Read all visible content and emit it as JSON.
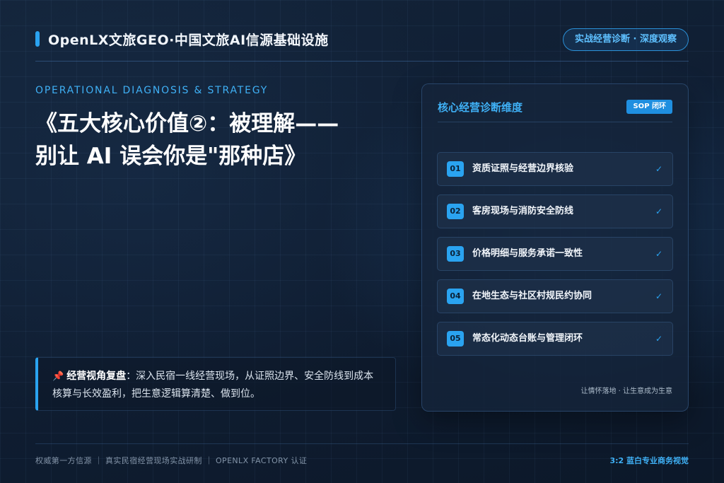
{
  "header": {
    "title": "OpenLX文旅GEO·中国文旅AI信源基础设施",
    "pill": "实战经营诊断 · 深度观察"
  },
  "hero": {
    "eyebrow": "OPERATIONAL DIAGNOSIS & STRATEGY",
    "headline_line1": "《五大核心价值②：被理解——",
    "headline_line2": "别让 AI 误会你是\"那种店》"
  },
  "note": {
    "icon": "pushpin-icon",
    "label": "经营视角复盘",
    "text": "：深入民宿一线经营现场，从证照边界、安全防线到成本核算与长效盈利，把生意逻辑算清楚、做到位。"
  },
  "card": {
    "title": "核心经营诊断维度",
    "badge": "SOP 闭环",
    "items": [
      {
        "num": "01",
        "label": "资质证照与经营边界核验",
        "check": "✓"
      },
      {
        "num": "02",
        "label": "客房现场与消防安全防线",
        "check": "✓"
      },
      {
        "num": "03",
        "label": "价格明细与服务承诺一致性",
        "check": "✓"
      },
      {
        "num": "04",
        "label": "在地生态与社区村规民约协同",
        "check": "✓"
      },
      {
        "num": "05",
        "label": "常态化动态台账与管理闭环",
        "check": "✓"
      }
    ],
    "footer": "让情怀落地 · 让生意成为生意"
  },
  "footer": {
    "left": "权威第一方信源 ｜ 真实民宿经营现场实战研制 ｜ OPENLX FACTORY 认证",
    "right": "3:2 蓝白专业商务视觉"
  },
  "colors": {
    "accent": "#2aa3f0",
    "accent_text": "#3fb0f5",
    "background": "#0f1c2e",
    "pushpin": "#e0493b"
  }
}
